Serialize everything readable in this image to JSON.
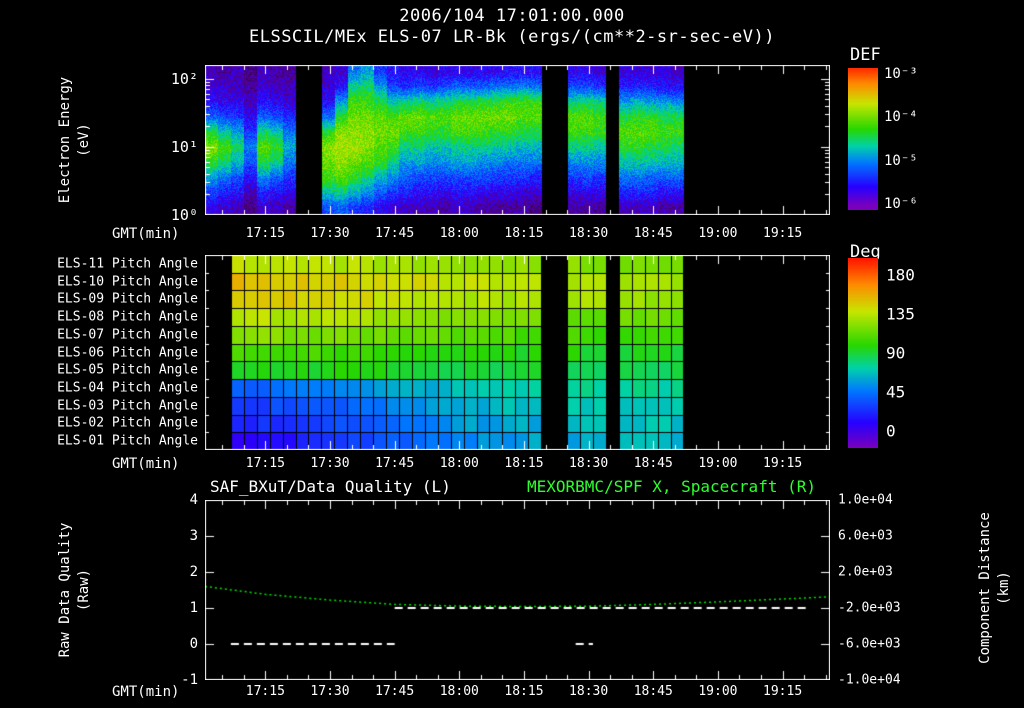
{
  "header": {
    "datetime": "2006/104 17:01:00.000",
    "subtitle": "ELSSCIL/MEx ELS-07 LR-Bk (ergs/(cm**2-sr-sec-eV))"
  },
  "colors": {
    "background": "#000000",
    "text": "#ffffff",
    "accent_green": "#2dff2d",
    "curve_green": "#00dd00"
  },
  "time_axis": {
    "label": "GMT(min)",
    "start_minutes": 0,
    "end_minutes": 145,
    "minor_tick_step": 5,
    "major_tick_minutes": [
      14,
      29,
      44,
      59,
      74,
      89,
      104,
      119,
      134
    ],
    "major_tick_labels": [
      "17:15",
      "17:30",
      "17:45",
      "18:00",
      "18:15",
      "18:30",
      "18:45",
      "19:00",
      "19:15"
    ]
  },
  "chart_data": [
    {
      "type": "heatmap",
      "name": "electron-energy-spectrogram",
      "units": "ergs/(cm**2-sr-sec-eV)",
      "xlabel": "GMT(min)",
      "ylabel": "Electron Energy (eV)",
      "ylabel_lines": [
        "Electron Energy",
        "(eV)"
      ],
      "yscale": "log",
      "ylim_log10": [
        0,
        2.2
      ],
      "ytick_log10": [
        2,
        1,
        0
      ],
      "ytick_labels": [
        "10²",
        "10¹",
        "10⁰"
      ],
      "colorbar": {
        "title": "DEF",
        "tick_log10": [
          -3,
          -4,
          -5,
          -6
        ],
        "tick_labels": [
          "10⁻³",
          "10⁻⁴",
          "10⁻⁵",
          "10⁻⁶"
        ],
        "range_log10": [
          -6.3,
          -2.9
        ]
      },
      "time_bin_minutes": 3,
      "data_end_minute": 111,
      "row_centers_log10": [
        2.1,
        1.88,
        1.66,
        1.44,
        1.22,
        1.0,
        0.78,
        0.56,
        0.34,
        0.12
      ],
      "columns_log10_flux": [
        [
          -6.0,
          -5.9,
          -5.7,
          -5.3,
          -4.5,
          -4.0,
          -4.4,
          -5.0,
          -5.5,
          -5.8
        ],
        [
          -6.1,
          -5.9,
          -5.8,
          -5.4,
          -4.8,
          -4.3,
          -4.6,
          -5.2,
          -5.6,
          -5.9
        ],
        [
          -6.0,
          -6.0,
          -5.8,
          -5.5,
          -5.0,
          -4.6,
          -4.9,
          -5.4,
          -5.7,
          -6.0
        ],
        [
          -6.2,
          -6.1,
          -6.0,
          -5.8,
          -5.5,
          -5.2,
          -5.4,
          -5.7,
          -6.0,
          -6.2
        ],
        [
          -6.0,
          -5.9,
          -5.7,
          -5.3,
          -4.6,
          -4.2,
          -4.5,
          -5.1,
          -5.6,
          -5.9
        ],
        [
          -6.1,
          -6.0,
          -5.8,
          -5.4,
          -4.8,
          -4.4,
          -4.7,
          -5.3,
          -5.7,
          -6.0
        ],
        [
          -6.1,
          -6.0,
          -5.9,
          -5.6,
          -5.2,
          -5.0,
          -5.2,
          -5.5,
          -5.8,
          -6.1
        ],
        null,
        null,
        [
          -6.0,
          -5.9,
          -5.7,
          -5.2,
          -4.4,
          -4.0,
          -4.1,
          -4.3,
          -4.8,
          -5.4
        ],
        [
          -5.9,
          -5.7,
          -5.0,
          -4.4,
          -4.0,
          -3.9,
          -4.0,
          -4.2,
          -4.7,
          -5.3
        ],
        [
          -5.2,
          -4.7,
          -4.3,
          -4.1,
          -4.0,
          -3.9,
          -4.1,
          -4.4,
          -4.9,
          -5.5
        ],
        [
          -5.0,
          -4.6,
          -4.3,
          -4.1,
          -4.0,
          -4.0,
          -4.2,
          -4.6,
          -5.1,
          -5.6
        ],
        [
          -5.5,
          -5.0,
          -4.5,
          -4.2,
          -4.1,
          -4.2,
          -4.4,
          -4.9,
          -5.3,
          -5.8
        ],
        [
          -5.7,
          -5.4,
          -4.8,
          -4.3,
          -4.1,
          -4.3,
          -4.7,
          -5.1,
          -5.5,
          -5.9
        ],
        [
          -5.8,
          -5.5,
          -4.7,
          -4.1,
          -4.3,
          -4.7,
          -5.0,
          -5.3,
          -5.6,
          -6.0
        ],
        [
          -5.8,
          -5.4,
          -4.6,
          -4.1,
          -4.3,
          -4.7,
          -5.0,
          -5.4,
          -5.7,
          -6.0
        ],
        [
          -5.9,
          -5.5,
          -4.7,
          -4.2,
          -4.4,
          -4.8,
          -5.1,
          -5.4,
          -5.7,
          -6.0
        ],
        [
          -5.8,
          -5.4,
          -4.6,
          -4.2,
          -4.4,
          -4.8,
          -5.1,
          -5.4,
          -5.8,
          -6.1
        ],
        [
          -5.8,
          -5.3,
          -4.5,
          -4.1,
          -4.3,
          -4.7,
          -5.0,
          -5.4,
          -5.7,
          -6.0
        ],
        [
          -5.8,
          -5.3,
          -4.5,
          -4.1,
          -4.3,
          -4.7,
          -5.0,
          -5.4,
          -5.7,
          -6.0
        ],
        [
          -5.8,
          -5.3,
          -4.4,
          -4.1,
          -4.3,
          -4.7,
          -5.1,
          -5.4,
          -5.8,
          -6.1
        ],
        [
          -5.8,
          -5.2,
          -4.4,
          -4.1,
          -4.4,
          -4.8,
          -5.1,
          -5.5,
          -5.8,
          -6.1
        ],
        [
          -5.7,
          -5.2,
          -4.3,
          -4.1,
          -4.4,
          -4.8,
          -5.2,
          -5.5,
          -5.8,
          -6.1
        ],
        [
          -5.7,
          -5.1,
          -4.3,
          -4.2,
          -4.5,
          -4.9,
          -5.2,
          -5.5,
          -5.9,
          -6.1
        ],
        [
          -5.7,
          -5.2,
          -4.3,
          -4.2,
          -4.5,
          -4.9,
          -5.2,
          -5.6,
          -5.9,
          -6.2
        ],
        null,
        null,
        [
          -5.8,
          -5.4,
          -4.7,
          -4.2,
          -4.3,
          -4.7,
          -5.1,
          -5.5,
          -5.8,
          -6.1
        ],
        [
          -5.8,
          -5.4,
          -4.6,
          -4.2,
          -4.3,
          -4.7,
          -5.1,
          -5.4,
          -5.8,
          -6.1
        ],
        [
          -5.9,
          -5.5,
          -4.7,
          -4.3,
          -4.4,
          -4.8,
          -5.1,
          -5.5,
          -5.8,
          -6.1
        ],
        null,
        [
          -5.9,
          -5.6,
          -5.0,
          -4.5,
          -4.2,
          -4.4,
          -4.8,
          -5.2,
          -5.6,
          -6.0
        ],
        [
          -5.9,
          -5.6,
          -4.9,
          -4.4,
          -4.2,
          -4.4,
          -4.8,
          -5.2,
          -5.6,
          -6.0
        ],
        [
          -5.9,
          -5.6,
          -5.0,
          -4.4,
          -4.2,
          -4.5,
          -4.8,
          -5.3,
          -5.6,
          -6.0
        ],
        [
          -5.9,
          -5.7,
          -5.0,
          -4.5,
          -4.3,
          -4.5,
          -4.9,
          -5.3,
          -5.7,
          -6.1
        ],
        [
          -6.0,
          -5.7,
          -5.1,
          -4.5,
          -4.3,
          -4.6,
          -4.9,
          -5.3,
          -5.7,
          -6.1
        ]
      ]
    },
    {
      "type": "heatmap",
      "name": "pitch-angle-panel",
      "xlabel": "GMT(min)",
      "rows": [
        "ELS-11 Pitch Angle",
        "ELS-10 Pitch Angle",
        "ELS-09 Pitch Angle",
        "ELS-08 Pitch Angle",
        "ELS-07 Pitch Angle",
        "ELS-06 Pitch Angle",
        "ELS-05 Pitch Angle",
        "ELS-04 Pitch Angle",
        "ELS-03 Pitch Angle",
        "ELS-02 Pitch Angle",
        "ELS-01 Pitch Angle"
      ],
      "colorbar": {
        "title": "Deg",
        "ticks": [
          180,
          135,
          90,
          45,
          0
        ],
        "range": [
          0,
          180
        ]
      },
      "time_bin_minutes": 3,
      "data_end_minute": 111,
      "null_columns": [
        0,
        1,
        26,
        27,
        31
      ],
      "node_minutes": [
        0,
        14,
        29,
        44,
        59,
        74,
        89,
        111
      ],
      "row_values_deg": [
        [
          130,
          129,
          127,
          123,
          119,
          117,
          116,
          114
        ],
        [
          142,
          140,
          138,
          133,
          128,
          126,
          124,
          122
        ],
        [
          139,
          137,
          135,
          130,
          126,
          123,
          122,
          120
        ],
        [
          127,
          126,
          124,
          120,
          116,
          113,
          111,
          109
        ],
        [
          118,
          116,
          113,
          110,
          106,
          104,
          102,
          100
        ],
        [
          106,
          105,
          103,
          100,
          97,
          95,
          94,
          92
        ],
        [
          96,
          95,
          94,
          92,
          90,
          89,
          88,
          87
        ],
        [
          48,
          50,
          56,
          65,
          72,
          75,
          77,
          78
        ],
        [
          38,
          41,
          47,
          58,
          66,
          70,
          72,
          74
        ],
        [
          30,
          34,
          41,
          52,
          62,
          66,
          69,
          71
        ],
        [
          21,
          25,
          34,
          47,
          58,
          63,
          66,
          69
        ]
      ]
    },
    {
      "type": "line",
      "name": "quality-and-distance-panel",
      "xlabel": "GMT(min)",
      "titles": {
        "left": "SAF_BXuT/Data Quality (L)",
        "right": "MEXORBMC/SPF X, Spacecraft (R)"
      },
      "left_axis": {
        "label": "Raw Data Quality (Raw)",
        "label_lines": [
          "Raw Data Quality",
          "(Raw)"
        ],
        "ticks": [
          4,
          3,
          2,
          1,
          0,
          -1
        ],
        "lim": [
          -1,
          4
        ]
      },
      "right_axis": {
        "label": "Component Distance (km)",
        "label_lines": [
          "Component Distance",
          "(km)"
        ],
        "tick_values": [
          10000,
          6000,
          2000,
          -2000,
          -6000,
          -10000
        ],
        "tick_labels": [
          "1.0e+04",
          "6.0e+03",
          "2.0e+03",
          "-2.0e+03",
          "-6.0e+03",
          "-1.0e+04"
        ],
        "lim": [
          -10000,
          10000
        ]
      },
      "series": [
        {
          "name": "MEXORBMC/SPF X Spacecraft",
          "axis": "right",
          "style": "dotted",
          "color": "#00dd00",
          "x_minutes": [
            0,
            14,
            29,
            44,
            59,
            74,
            89,
            104,
            119,
            134,
            145
          ],
          "values_km": [
            400,
            -480,
            -1120,
            -1600,
            -1790,
            -1840,
            -1800,
            -1600,
            -1320,
            -1000,
            -760
          ]
        },
        {
          "name": "SAF_BXuT Data Quality",
          "axis": "left",
          "style": "dashed",
          "color": "#ffffff",
          "segments": [
            {
              "value": 0,
              "from_minute": 6,
              "to_minute": 44
            },
            {
              "value": 0,
              "from_minute": 86,
              "to_minute": 90
            },
            {
              "value": 1,
              "from_minute": 44,
              "to_minute": 140
            }
          ]
        }
      ]
    }
  ]
}
